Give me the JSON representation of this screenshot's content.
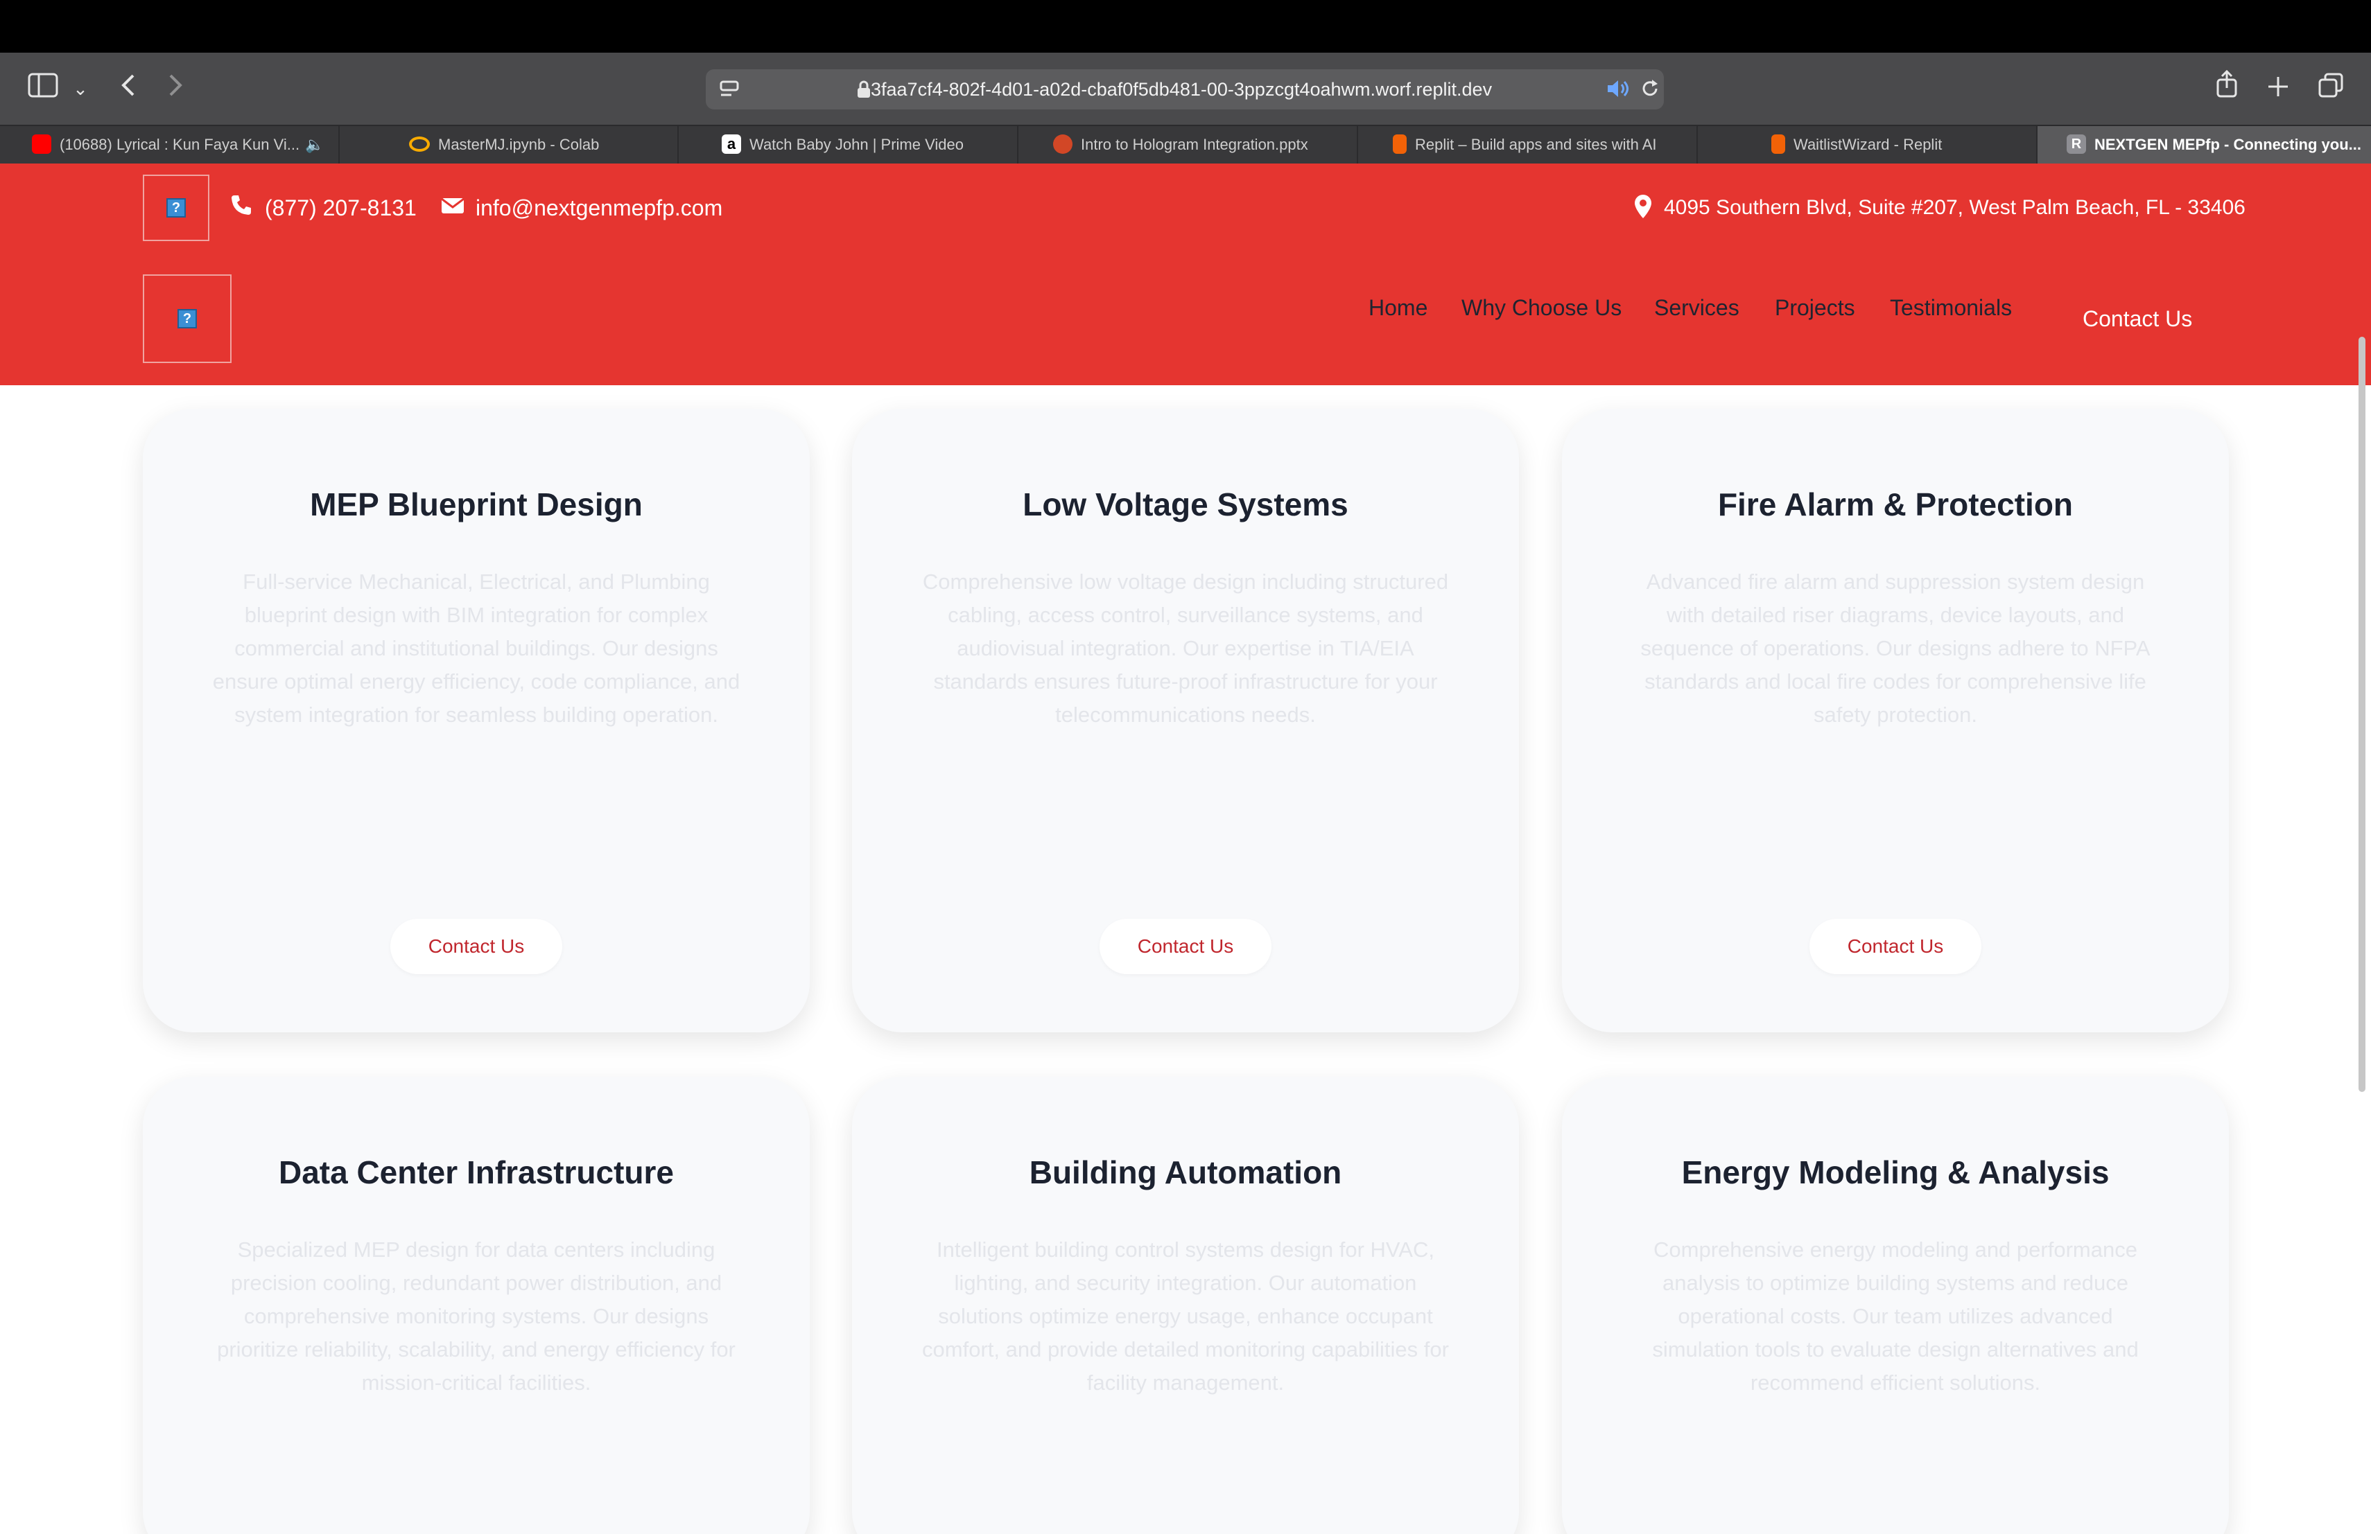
{
  "browser": {
    "url": "3faa7cf4-802f-4d01-a02d-cbaf0f5db481-00-3ppzcgt4oahwm.worf.replit.dev",
    "icons": [
      "sidebar-icon",
      "chevron-down-icon",
      "back-icon",
      "forward-icon",
      "site-settings-icon",
      "lock-icon",
      "speaker-icon",
      "reload-icon",
      "share-icon",
      "new-tab-icon",
      "tab-overview-icon"
    ],
    "tabs": [
      {
        "label": "(10688) Lyrical : Kun Faya Kun Vi...",
        "favicon_color": "#ff0000"
      },
      {
        "label": "MasterMJ.ipynb - Colab",
        "favicon_color": "#f9ab00"
      },
      {
        "label": "Watch Baby John | Prime Video",
        "favicon_color": "#ffffff"
      },
      {
        "label": "Intro to Hologram Integration.pptx",
        "favicon_color": "#d24726"
      },
      {
        "label": "Replit – Build apps and sites with AI",
        "favicon_color": "#f26207"
      },
      {
        "label": "WaitlistWizard - Replit",
        "favicon_color": "#f26207"
      },
      {
        "label": "NEXTGEN MEPfp - Connecting you...",
        "favicon_color": "#8e8e93",
        "favicon_letter": "R",
        "active": true
      }
    ]
  },
  "header": {
    "phone": "(877) 207-8131",
    "email": "info@nextgenmepfp.com",
    "address": "4095 Southern Blvd, Suite #207, West Palm Beach, FL - 33406",
    "bg_color": "#e53530",
    "nav": [
      "Home",
      "Why Choose Us",
      "Services",
      "Projects",
      "Testimonials"
    ],
    "nav_contact": "Contact Us"
  },
  "services": [
    {
      "title": "MEP Blueprint Design",
      "desc": "Full-service Mechanical, Electrical, and Plumbing blueprint design with BIM integration for complex commercial and institutional buildings. Our designs ensure optimal energy efficiency, code compliance, and system integration for seamless building operation.",
      "button": "Contact Us"
    },
    {
      "title": "Low Voltage Systems",
      "desc": "Comprehensive low voltage design including structured cabling, access control, surveillance systems, and audiovisual integration. Our expertise in TIA/EIA standards ensures future-proof infrastructure for your telecommunications needs.",
      "button": "Contact Us"
    },
    {
      "title": "Fire Alarm & Protection",
      "desc": "Advanced fire alarm and suppression system design with detailed riser diagrams, device layouts, and sequence of operations. Our designs adhere to NFPA standards and local fire codes for comprehensive life safety protection.",
      "button": "Contact Us"
    },
    {
      "title": "Data Center Infrastructure",
      "desc": "Specialized MEP design for data centers including precision cooling, redundant power distribution, and comprehensive monitoring systems. Our designs prioritize reliability, scalability, and energy efficiency for mission-critical facilities."
    },
    {
      "title": "Building Automation",
      "desc": "Intelligent building control systems design for HVAC, lighting, and security integration. Our automation solutions optimize energy usage, enhance occupant comfort, and provide detailed monitoring capabilities for facility management."
    },
    {
      "title": "Energy Modeling & Analysis",
      "desc": "Comprehensive energy modeling and performance analysis to optimize building systems and reduce operational costs. Our team utilizes advanced simulation tools to evaluate design alternatives and recommend efficient solutions."
    }
  ]
}
